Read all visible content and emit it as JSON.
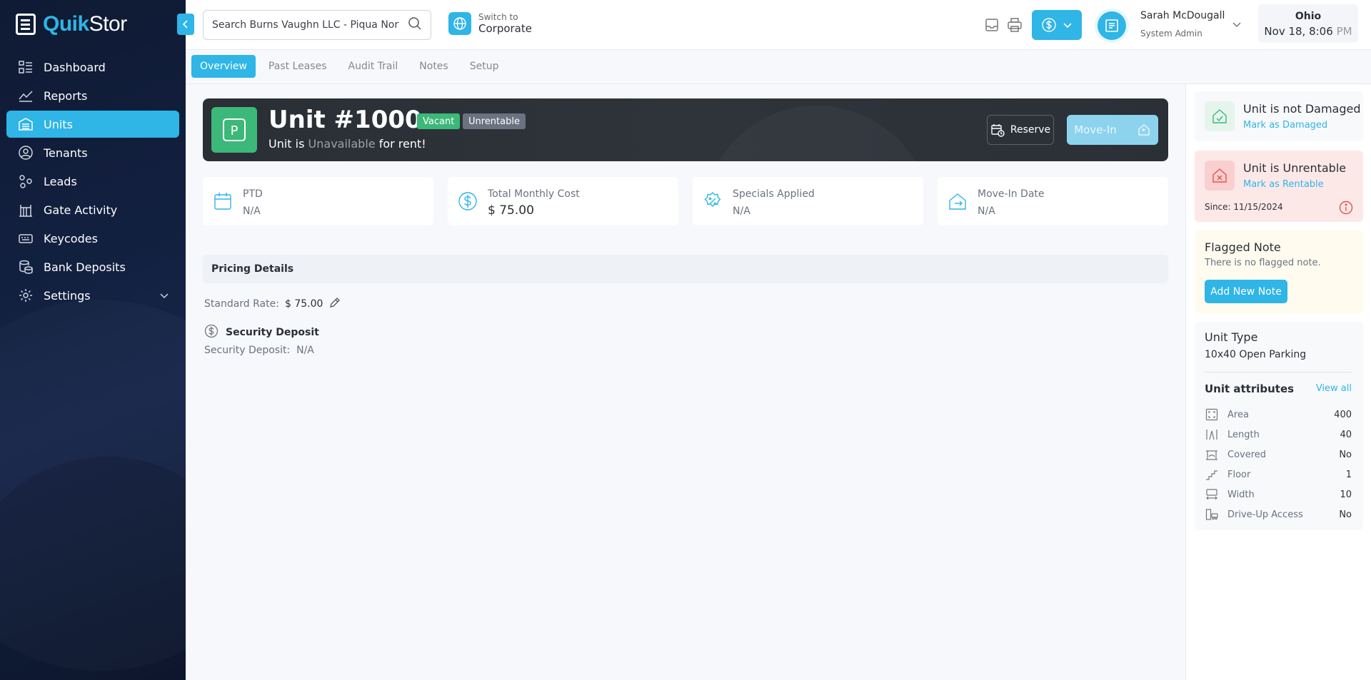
{
  "brand": {
    "name_bold": "Quik",
    "name_rest": "Stor"
  },
  "nav": {
    "items": [
      {
        "label": "Dashboard",
        "icon": "dashboard-icon",
        "active": false
      },
      {
        "label": "Reports",
        "icon": "reports-icon",
        "active": false
      },
      {
        "label": "Units",
        "icon": "units-icon",
        "active": true
      },
      {
        "label": "Tenants",
        "icon": "tenants-icon",
        "active": false
      },
      {
        "label": "Leads",
        "icon": "leads-icon",
        "active": false
      },
      {
        "label": "Gate Activity",
        "icon": "gate-icon",
        "active": false
      },
      {
        "label": "Keycodes",
        "icon": "keycodes-icon",
        "active": false
      },
      {
        "label": "Bank Deposits",
        "icon": "bank-icon",
        "active": false
      },
      {
        "label": "Settings",
        "icon": "gear-icon",
        "active": false
      }
    ]
  },
  "topbar": {
    "search_placeholder": "Search Burns Vaughn LLC - Piqua North St",
    "switch_small": "Switch to",
    "switch_big": "Corporate",
    "user_name": "Sarah McDougall",
    "user_role": "System Admin",
    "location": "Ohio",
    "time": "Nov 18, 8:06",
    "time_suffix": "PM"
  },
  "tabs": [
    "Overview",
    "Past Leases",
    "Audit Trail",
    "Notes",
    "Setup"
  ],
  "unit": {
    "tile_letter": "P",
    "title": "Unit #1000",
    "badges": {
      "vacant": "Vacant",
      "unrentable": "Unrentable"
    },
    "sub_prefix": "Unit is",
    "sub_status": "Unavailable",
    "sub_suffix": "for rent!",
    "reserve_label": "Reserve",
    "movein_label": "Move-In"
  },
  "stats": [
    {
      "label": "PTD",
      "value": "N/A",
      "icon": "calendar-icon"
    },
    {
      "label": "Total Monthly Cost",
      "value": "75.00",
      "currency": "$",
      "icon": "dollar-circle-icon"
    },
    {
      "label": "Specials Applied",
      "value": "N/A",
      "icon": "percent-badge-icon"
    },
    {
      "label": "Move-In Date",
      "value": "N/A",
      "icon": "move-in-icon"
    }
  ],
  "pricing": {
    "header": "Pricing Details",
    "std_label": "Standard Rate:",
    "std_value": "$ 75.00",
    "security_title": "Security Deposit",
    "security_label": "Security Deposit:",
    "security_value": "N/A"
  },
  "right": {
    "damaged_title": "Unit is not Damaged",
    "damaged_link": "Mark as Damaged",
    "unrentable_title": "Unit is Unrentable",
    "unrentable_link": "Mark as Rentable",
    "since_label": "Since:",
    "since_date": "11/15/2024",
    "flag_title": "Flagged Note",
    "flag_text": "There is no flagged note.",
    "add_note": "Add New Note",
    "type_title": "Unit Type",
    "type_value": "10x40 Open Parking",
    "attr_title": "Unit attributes",
    "view_all": "View all",
    "attributes": [
      {
        "label": "Area",
        "value": "400",
        "icon": "area-icon"
      },
      {
        "label": "Length",
        "value": "40",
        "icon": "length-icon"
      },
      {
        "label": "Covered",
        "value": "No",
        "icon": "covered-icon"
      },
      {
        "label": "Floor",
        "value": "1",
        "icon": "floor-icon"
      },
      {
        "label": "Width",
        "value": "10",
        "icon": "width-icon"
      },
      {
        "label": "Drive-Up Access",
        "value": "No",
        "icon": "drive-up-icon"
      }
    ]
  },
  "colors": {
    "accent": "#2fb5e6",
    "success": "#3cb879",
    "danger": "#e5534b"
  }
}
